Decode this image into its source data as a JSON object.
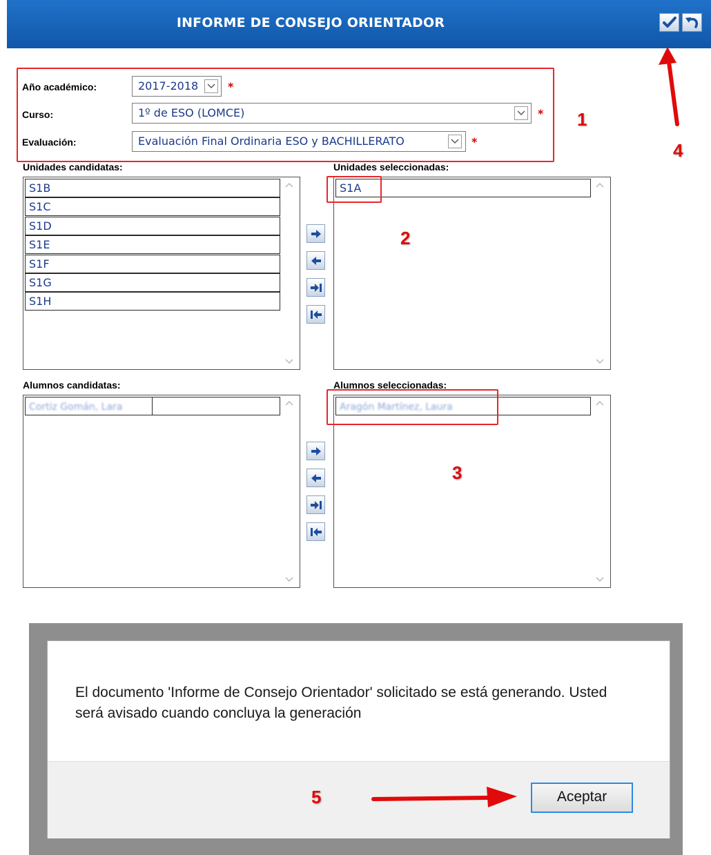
{
  "header": {
    "title": "INFORME DE CONSEJO ORIENTADOR"
  },
  "form": {
    "academic_year_label": "Año académico:",
    "academic_year_value": "2017-2018",
    "course_label": "Curso:",
    "course_value": "1º de ESO (LOMCE)",
    "evaluation_label": "Evaluación:",
    "evaluation_value": "Evaluación Final Ordinaria ESO y BACHILLERATO",
    "required_mark": "*"
  },
  "units": {
    "candidates_label": "Unidades candidatas:",
    "selected_label": "Unidades seleccionadas:",
    "candidates": [
      "S1B",
      "S1C",
      "S1D",
      "S1E",
      "S1F",
      "S1G",
      "S1H"
    ],
    "selected": [
      "S1A"
    ]
  },
  "students": {
    "candidates_label": "Alumnos candidatas:",
    "selected_label": "Alumnos seleccionadas:",
    "candidates": [
      "Cortiz Gomán, Lara"
    ],
    "selected": [
      "Aragón Martínez, Laura"
    ]
  },
  "annotations": {
    "n1": "1",
    "n2": "2",
    "n3": "3",
    "n4": "4",
    "n5": "5"
  },
  "dialog": {
    "message": "El documento 'Informe de Consejo Orientador' solicitado se está generando. Usted será avisado cuando concluya la generación",
    "accept_label": "Aceptar"
  },
  "colors": {
    "header_blue": "#1565c0",
    "annotation_red": "#e10a0a",
    "list_text": "#1b3a8c"
  },
  "icons": [
    "check-icon",
    "undo-icon",
    "chevron-down-icon",
    "chevron-up-icon",
    "arrow-right-icon",
    "arrow-left-icon",
    "move-all-right-icon",
    "move-all-left-icon"
  ]
}
